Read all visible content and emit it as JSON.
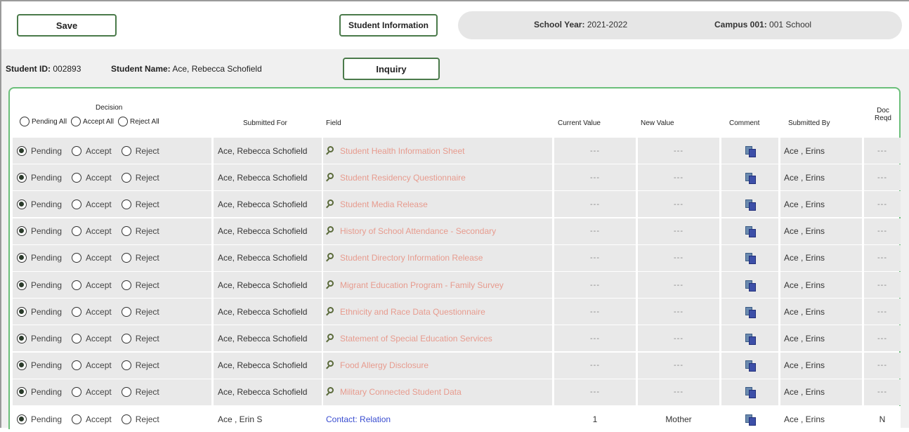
{
  "toolbar": {
    "save_label": "Save",
    "student_info_label": "Student Information",
    "school_year_label": "School Year:",
    "school_year_value": "2021-2022",
    "campus_label": "Campus 001:",
    "campus_value": "001 School"
  },
  "student": {
    "id_label": "Student ID:",
    "id_value": "002893",
    "name_label": "Student Name:",
    "name_value": "Ace, Rebecca Schofield",
    "inquiry_label": "Inquiry"
  },
  "grid": {
    "decision_header": "Decision",
    "pending_all": "Pending All",
    "accept_all": "Accept All",
    "reject_all": "Reject All",
    "columns": {
      "submitted_for": "Submitted For",
      "field": "Field",
      "current_value": "Current Value",
      "new_value": "New Value",
      "comment": "Comment",
      "submitted_by": "Submitted By",
      "doc_reqd_1": "Doc",
      "doc_reqd_2": "Reqd"
    },
    "options": {
      "pending": "Pending",
      "accept": "Accept",
      "reject": "Reject"
    },
    "rows": [
      {
        "submitted_for": "Ace, Rebecca Schofield",
        "field": "Student Health Information Sheet",
        "current": "---",
        "new": "---",
        "by": "Ace , Erins",
        "doc": "---",
        "type": "form"
      },
      {
        "submitted_for": "Ace, Rebecca Schofield",
        "field": "Student Residency Questionnaire",
        "current": "---",
        "new": "---",
        "by": "Ace , Erins",
        "doc": "---",
        "type": "form"
      },
      {
        "submitted_for": "Ace, Rebecca Schofield",
        "field": "Student Media Release",
        "current": "---",
        "new": "---",
        "by": "Ace , Erins",
        "doc": "---",
        "type": "form"
      },
      {
        "submitted_for": "Ace, Rebecca Schofield",
        "field": "History of School Attendance - Secondary",
        "current": "---",
        "new": "---",
        "by": "Ace , Erins",
        "doc": "---",
        "type": "form"
      },
      {
        "submitted_for": "Ace, Rebecca Schofield",
        "field": "Student Directory Information Release",
        "current": "---",
        "new": "---",
        "by": "Ace , Erins",
        "doc": "---",
        "type": "form"
      },
      {
        "submitted_for": "Ace, Rebecca Schofield",
        "field": "Migrant Education Program - Family Survey",
        "current": "---",
        "new": "---",
        "by": "Ace , Erins",
        "doc": "---",
        "type": "form"
      },
      {
        "submitted_for": "Ace, Rebecca Schofield",
        "field": "Ethnicity and Race Data Questionnaire",
        "current": "---",
        "new": "---",
        "by": "Ace , Erins",
        "doc": "---",
        "type": "form"
      },
      {
        "submitted_for": "Ace, Rebecca Schofield",
        "field": "Statement of Special Education Services",
        "current": "---",
        "new": "---",
        "by": "Ace , Erins",
        "doc": "---",
        "type": "form"
      },
      {
        "submitted_for": "Ace, Rebecca Schofield",
        "field": "Food Allergy Disclosure",
        "current": "---",
        "new": "---",
        "by": "Ace , Erins",
        "doc": "---",
        "type": "form"
      },
      {
        "submitted_for": "Ace, Rebecca Schofield",
        "field": "Military Connected Student Data",
        "current": "---",
        "new": "---",
        "by": "Ace , Erins",
        "doc": "---",
        "type": "form"
      },
      {
        "submitted_for": "Ace , Erin S",
        "field": "Contact: Relation",
        "current": "1",
        "new": "Mother",
        "by": "Ace , Erins",
        "doc": "N",
        "type": "contact"
      }
    ],
    "icons": {
      "view": "magnifier-icon",
      "comment": "comment-document-icon"
    },
    "colors": {
      "form_link": "#e79b8e",
      "contact_link": "#3a4dd0",
      "panel_border": "#6bbf7a"
    }
  }
}
